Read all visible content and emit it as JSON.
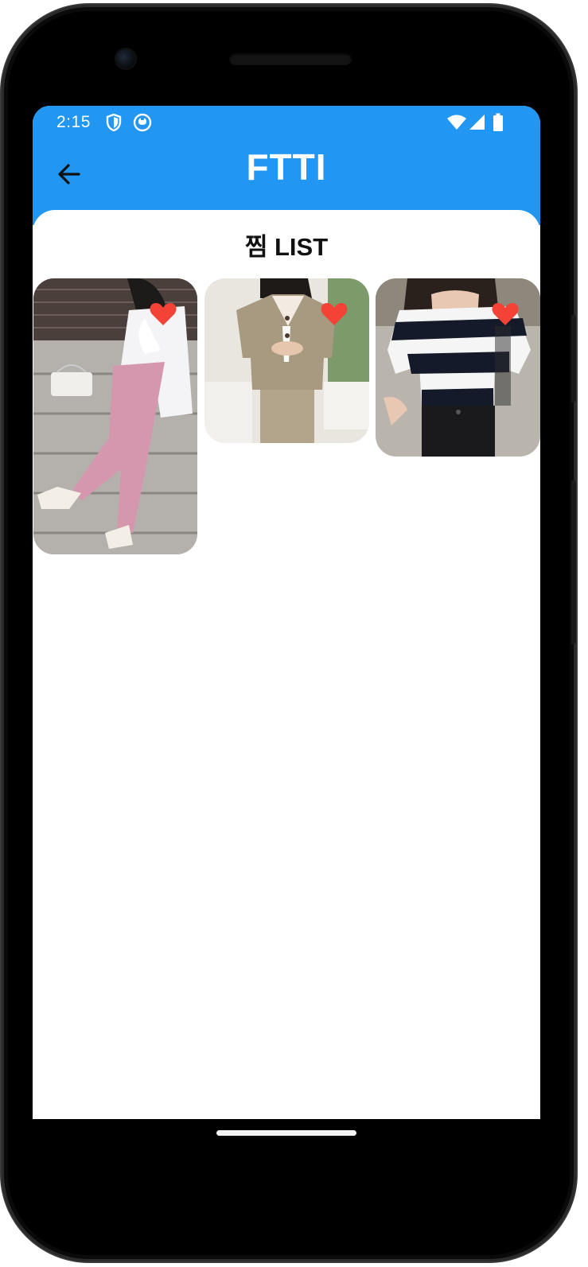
{
  "status_bar": {
    "time": "2:15",
    "icons": [
      "shield-icon",
      "app-notification-icon",
      "wifi-icon",
      "signal-icon",
      "battery-icon"
    ]
  },
  "app_bar": {
    "title": "FTTI",
    "back_icon": "arrow-left-icon",
    "color": "#2196F3"
  },
  "wishlist": {
    "heading": "찜 LIST",
    "items": [
      {
        "favorite": true,
        "description_icon": "outfit-photo-white-blazer-pink-pants"
      },
      {
        "favorite": true,
        "description_icon": "outfit-photo-beige-suit-set"
      },
      {
        "favorite": true,
        "description_icon": "outfit-photo-striped-top"
      }
    ],
    "heart_color": "#F44336"
  }
}
